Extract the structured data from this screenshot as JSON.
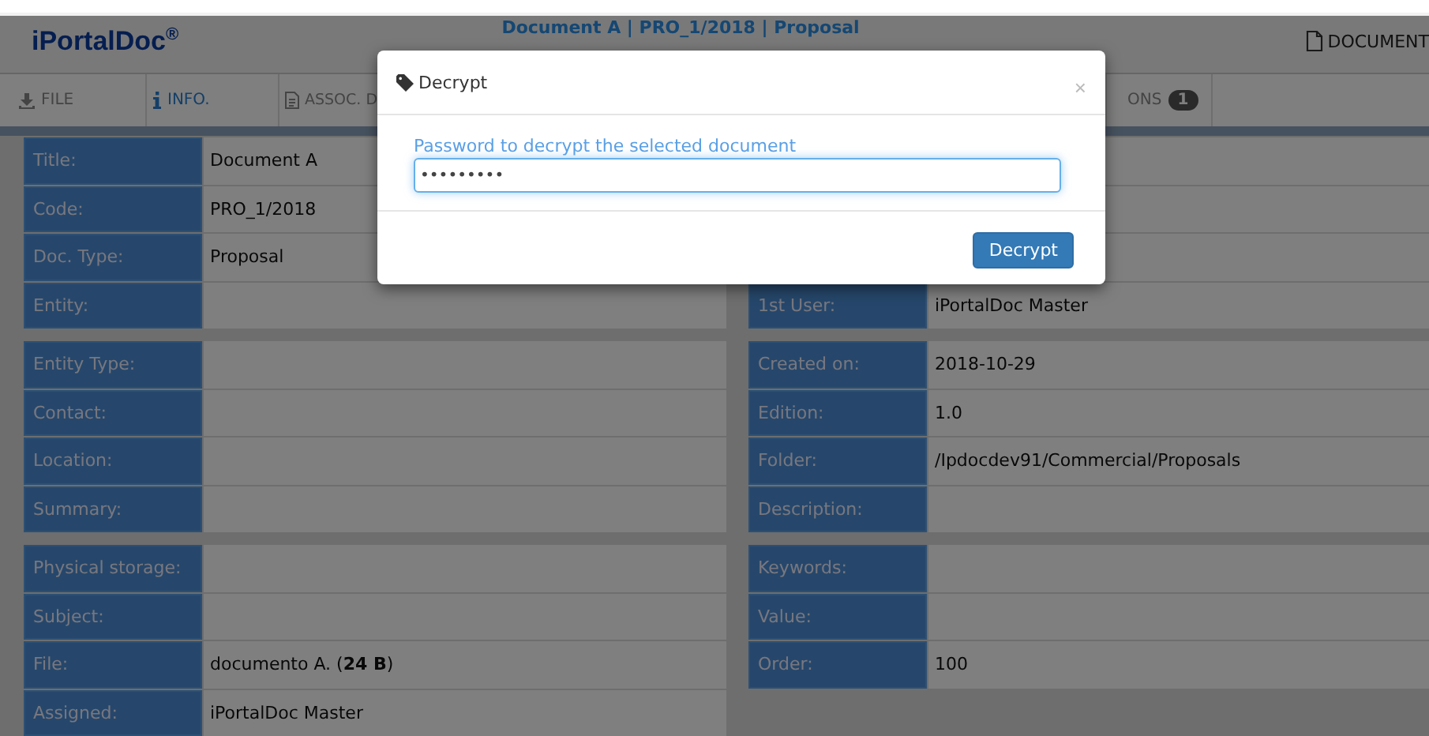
{
  "header": {
    "brand": "iPortalDoc$^{®}$",
    "document_title": "Document A | PRO_1/2018 | Proposal",
    "document_button": "DOCUMENT"
  },
  "tabs": [
    {
      "label": "FILE",
      "selected": false
    },
    {
      "label": "INFO.",
      "selected": true
    },
    {
      "label": "ASSOC. D",
      "selected": false
    },
    {
      "label": "ONS",
      "selected": false,
      "badge": "1"
    }
  ],
  "columns": [
    {
      "groups": [
        {
          "rows": [
            {
              "label": "Title:",
              "value": "Document A"
            },
            {
              "label": "Code:",
              "value": "PRO_1/2018"
            },
            {
              "label": "Doc. Type:",
              "value": "Proposal"
            },
            {
              "label": "Entity:"
            }
          ]
        },
        {
          "rows": [
            {
              "label": "Entity Type:"
            },
            {
              "label": "Contact:"
            },
            {
              "label": "Location:"
            },
            {
              "label": "Summary:"
            }
          ]
        },
        {
          "rows": [
            {
              "label": "Physical storage:"
            },
            {
              "label": "Subject:"
            },
            {
              "label": "File:",
              "value": "documento A. (**24 B**)"
            },
            {
              "label": "Assigned:",
              "value": "iPortalDoc Master"
            }
          ]
        }
      ]
    },
    {
      "groups": [
        {
          "rows": [
            {},
            {},
            {},
            {
              "label": "1st User:",
              "value": "iPortalDoc Master"
            }
          ]
        },
        {
          "rows": [
            {
              "label": "Created on:",
              "value": "2018-10-29"
            },
            {
              "label": "Edition:",
              "value": "1.0"
            },
            {
              "label": "Folder:",
              "value": "/Ipdocdev91/Commercial/Proposals"
            },
            {
              "label": "Description:"
            }
          ]
        },
        {
          "rows": [
            {
              "label": "Keywords:"
            },
            {
              "label": "Value:"
            },
            {
              "label": "Order:",
              "value": "100"
            }
          ]
        }
      ]
    }
  ],
  "dialog": {
    "title": "Decrypt",
    "close": "×",
    "field_label": "Password to decrypt the selected document",
    "field_value": "•••••••••",
    "focused": true,
    "button": "Decrypt"
  }
}
